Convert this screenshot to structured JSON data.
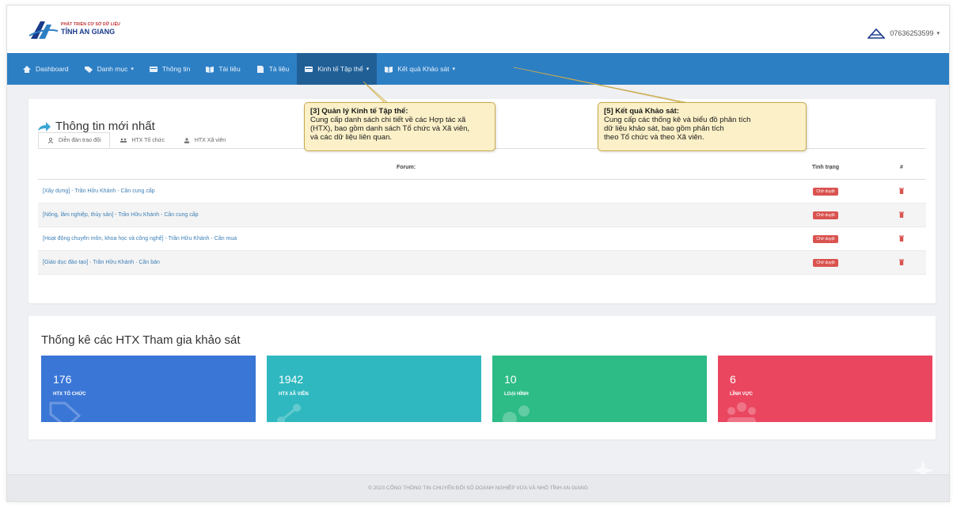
{
  "brand": {
    "tagline": "PHÁT TRIỂN CƠ SỞ DỮ LIỆU",
    "name": "TỈNH AN GIANG"
  },
  "user": {
    "phone": "07636253599",
    "caret": "▾"
  },
  "nav": {
    "items": [
      {
        "label": "Dashboard",
        "icon": "home-icon",
        "caret": ""
      },
      {
        "label": "Danh mục",
        "icon": "tag-icon",
        "caret": "▾"
      },
      {
        "label": "Thông tin",
        "icon": "card-icon",
        "caret": ""
      },
      {
        "label": "Tài liệu",
        "icon": "book-icon",
        "caret": ""
      },
      {
        "label": "Tà liệu",
        "icon": "file-icon",
        "caret": ""
      },
      {
        "label": "Kinh tế Tập thể",
        "icon": "card-icon",
        "caret": "▾"
      },
      {
        "label": "Kết quả Khảo sát",
        "icon": "book-icon",
        "caret": "▾"
      }
    ]
  },
  "latest": {
    "title": "Thông tin mới nhất",
    "tabs": [
      "Diễn đàn trao đổi",
      "HTX Tổ chức",
      "HTX Xã viên"
    ],
    "columns": {
      "forum": "Forum:",
      "status": "Tình trạng",
      "action": "#"
    },
    "rows": [
      {
        "text": "[Xây dựng] - Trần Hữu Khánh - Cần cung cấp",
        "status": "Chờ duyệt"
      },
      {
        "text": "[Nông, lâm nghiệp, thủy sản] - Trần Hữu Khánh - Cần cung cấp",
        "status": "Chờ duyệt"
      },
      {
        "text": "[Hoạt động chuyên môn, khoa học và công nghệ] - Trần Hữu Khánh - Cần mua",
        "status": "Chờ duyệt"
      },
      {
        "text": "[Giáo dục đào tạo] · Trần Hữu Khánh · Cần bán",
        "status": "Chờ duyệt"
      }
    ]
  },
  "callouts": {
    "c1": {
      "title": "[3] Quản lý Kinh tế Tập thể:",
      "l1": "Cung cấp danh sách chi tiết về các Hợp tác xã",
      "l2": "(HTX), bao gồm danh sách Tổ chức và Xã viên,",
      "l3": "và các dữ liệu liên quan."
    },
    "c2": {
      "title": "[5] Kết quả Khảo sát:",
      "l1": "Cung cấp các thống kê và biểu đồ phân tích",
      "l2": "dữ liệu khảo sát, bao gồm phân tích",
      "l3": "theo Tổ chức và theo Xã viên."
    }
  },
  "stats": {
    "title": "Thống kê các HTX Tham gia khảo sát",
    "cards": [
      {
        "value": "176",
        "label": "HTX TỔ CHỨC",
        "color": "#3a76d6"
      },
      {
        "value": "1942",
        "label": "HTX XÃ VIÊN",
        "color": "#2fb8bf"
      },
      {
        "value": "10",
        "label": "LOẠI HÌNH",
        "color": "#2dbb86"
      },
      {
        "value": "6",
        "label": "LĨNH VỰC",
        "color": "#ea4660"
      }
    ]
  },
  "footer": "© 2023 CỔNG THÔNG TIN CHUYỂN ĐỔI SỐ DOANH NGHIỆP VỪA VÀ NHỎ TỈNH AN GIANG"
}
